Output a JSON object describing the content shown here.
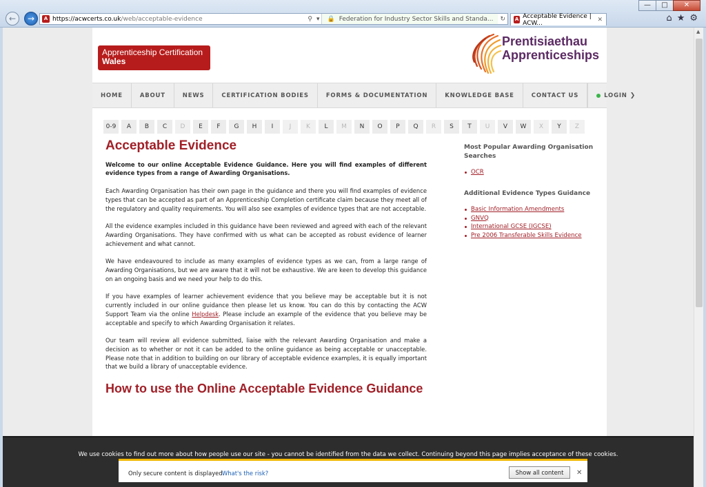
{
  "browser": {
    "url_domain": "https://acwcerts.co.uk",
    "url_path": "/web/acceptable-evidence",
    "site_identity": "Federation for Industry Sector Skills and Standa...",
    "tab_title": "Acceptable Evidence | ACW...",
    "favicon_letter": "A"
  },
  "header": {
    "logo_left_line1": "Apprenticeship Certification",
    "logo_left_line2": "Wales",
    "logo_right_line1": "Prentisiaethau",
    "logo_right_line2": "Apprenticeships"
  },
  "nav": {
    "items": [
      "HOME",
      "ABOUT",
      "NEWS",
      "CERTIFICATION BODIES",
      "FORMS & DOCUMENTATION",
      "KNOWLEDGE BASE",
      "CONTACT US"
    ],
    "login": "LOGIN"
  },
  "alphabet": [
    {
      "l": "0-9",
      "on": true
    },
    {
      "l": "A",
      "on": true
    },
    {
      "l": "B",
      "on": true
    },
    {
      "l": "C",
      "on": true
    },
    {
      "l": "D",
      "on": false
    },
    {
      "l": "E",
      "on": true
    },
    {
      "l": "F",
      "on": true
    },
    {
      "l": "G",
      "on": true
    },
    {
      "l": "H",
      "on": true
    },
    {
      "l": "I",
      "on": true
    },
    {
      "l": "J",
      "on": false
    },
    {
      "l": "K",
      "on": false
    },
    {
      "l": "L",
      "on": true
    },
    {
      "l": "M",
      "on": false
    },
    {
      "l": "N",
      "on": true
    },
    {
      "l": "O",
      "on": true
    },
    {
      "l": "P",
      "on": true
    },
    {
      "l": "Q",
      "on": true
    },
    {
      "l": "R",
      "on": false
    },
    {
      "l": "S",
      "on": true
    },
    {
      "l": "T",
      "on": true
    },
    {
      "l": "U",
      "on": false
    },
    {
      "l": "V",
      "on": true
    },
    {
      "l": "W",
      "on": true
    },
    {
      "l": "X",
      "on": false
    },
    {
      "l": "Y",
      "on": true
    },
    {
      "l": "Z",
      "on": false
    }
  ],
  "main": {
    "title": "Acceptable Evidence",
    "lead": "Welcome to our online Acceptable Evidence Guidance. Here you will find examples of different evidence types from a range of Awarding Organisations.",
    "p1": "Each Awarding Organisation has their own page in the guidance and there you will find examples of evidence types that can be accepted as part of an Apprenticeship Completion certificate claim because they meet all of the regulatory and quality requirements. You will also see examples of evidence types that are not acceptable.",
    "p2": "All the evidence examples included in this guidance have been reviewed and agreed with each of the relevant Awarding Organisations. They have confirmed with us what can be accepted as robust evidence of learner achievement and what cannot.",
    "p3": "We have endeavoured to include as many examples of evidence types as we can, from a large range of Awarding Organisations, but we are aware that it will not be exhaustive. We are keen to develop this guidance on an ongoing basis and we need your help to do this.",
    "p4_before": "If you have examples of learner achievement evidence that you believe may be acceptable but it is not currently included in our online guidance then please let us know. You can do this by contacting the ACW Support Team via the online ",
    "p4_link": "Helpdesk",
    "p4_after": ". Please include an example of the evidence that you believe may be acceptable and specify to which Awarding Organisation it relates.",
    "p5": "Our team will review all evidence submitted, liaise with the relevant Awarding Organisation and make a decision as to whether or not it can be added to the online guidance as being acceptable or unacceptable. Please note that in addition to building on our library of acceptable evidence examples, it is equally important that we build a library of unacceptable evidence.",
    "h2": "How to use the Online Acceptable Evidence Guidance"
  },
  "sidebar": {
    "popular_title": "Most Popular Awarding Organisation Searches",
    "popular_items": [
      "OCR"
    ],
    "additional_title": "Additional Evidence Types Guidance",
    "additional_items": [
      "Basic Information Amendments",
      "GNVQ",
      "International GCSE (IGCSE)",
      "Pre 2006 Transferable Skills Evidence"
    ]
  },
  "cookie": {
    "message": "We use cookies to find out more about how people use our site - you cannot be identified from the data we collect. Continuing beyond this page implies acceptance of these cookies."
  },
  "infobar": {
    "text": "Only secure content is displayed.",
    "link": "What's the risk?",
    "button": "Show all content"
  }
}
